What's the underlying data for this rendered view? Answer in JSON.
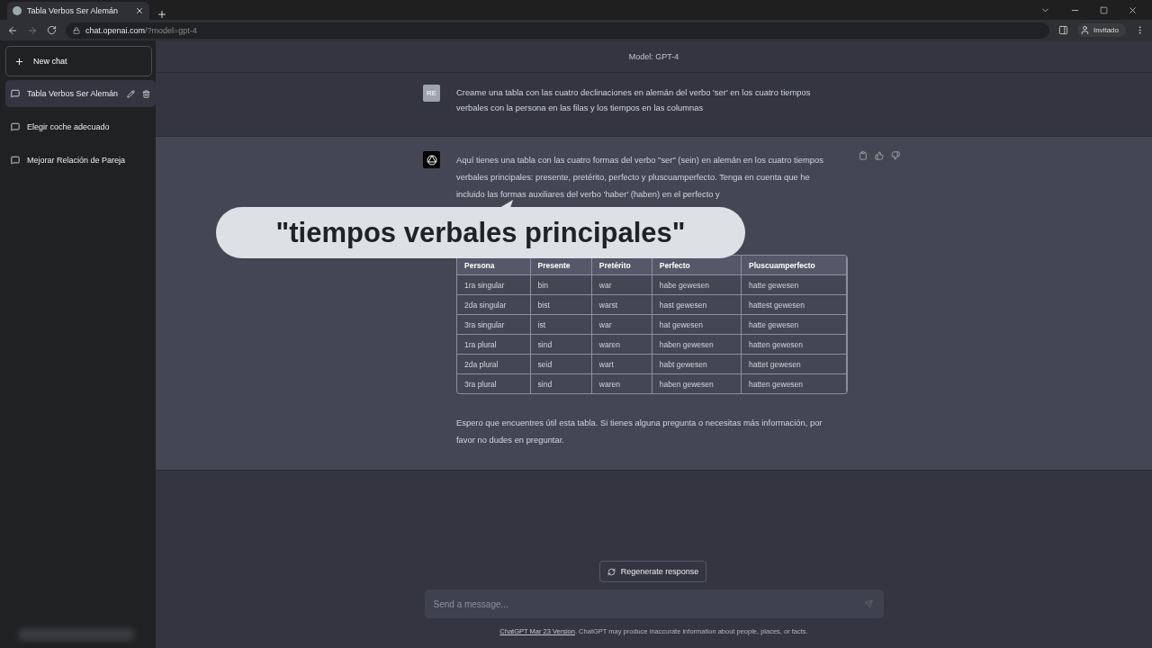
{
  "browser": {
    "tab_title": "Tabla Verbos Ser Alemán",
    "url_host": "chat.openai.com",
    "url_path": "/?model=gpt-4",
    "profile_label": "Invitado"
  },
  "sidebar": {
    "new_chat": "New chat",
    "chats": [
      {
        "title": "Tabla Verbos Ser Alemán",
        "selected": true
      },
      {
        "title": "Elegir coche adecuado",
        "selected": false
      },
      {
        "title": "Mejorar Relación de Pareja",
        "selected": false
      }
    ]
  },
  "model_label": "Model: GPT-4",
  "messages": [
    {
      "kind": "user",
      "avatar": "RE",
      "text": "Creame una tabla con las cuatro declinaciones en alemán del verbo 'ser' en los cuatro tiempos verbales con la persona en las filas y los tiempos en las columnas"
    },
    {
      "kind": "assistant",
      "text": "Aquí tienes una tabla con las cuatro formas del verbo \"ser\" (sein) en alemán en los cuatro tiempos verbales principales: presente, pretérito, perfecto y pluscuamperfecto. Tenga en cuenta que he incluido las formas auxiliares del verbo 'haber' (haben) en el perfecto y",
      "table": {
        "columns": [
          "Persona",
          "Presente",
          "Pretérito",
          "Perfecto",
          "Pluscuamperfecto"
        ],
        "rows": [
          [
            "1ra singular",
            "bin",
            "war",
            "habe gewesen",
            "hatte gewesen"
          ],
          [
            "2da singular",
            "bist",
            "warst",
            "hast gewesen",
            "hattest gewesen"
          ],
          [
            "3ra singular",
            "ist",
            "war",
            "hat gewesen",
            "hatte gewesen"
          ],
          [
            "1ra plural",
            "sind",
            "waren",
            "haben gewesen",
            "hatten gewesen"
          ],
          [
            "2da plural",
            "seid",
            "wart",
            "habt gewesen",
            "hattet gewesen"
          ],
          [
            "3ra plural",
            "sind",
            "waren",
            "haben gewesen",
            "hatten gewesen"
          ]
        ]
      },
      "closing": "Espero que encuentres útil esta tabla. Si tienes alguna pregunta o necesitas más información, por favor no dudes en preguntar."
    }
  ],
  "caption": "\"tiempos verbales principales\"",
  "regenerate": "Regenerate response",
  "input": {
    "placeholder": "Send a message..."
  },
  "footer": {
    "link": "ChatGPT Mar 23 Version",
    "text": ". ChatGPT may produce inaccurate information about people, places, or facts."
  }
}
